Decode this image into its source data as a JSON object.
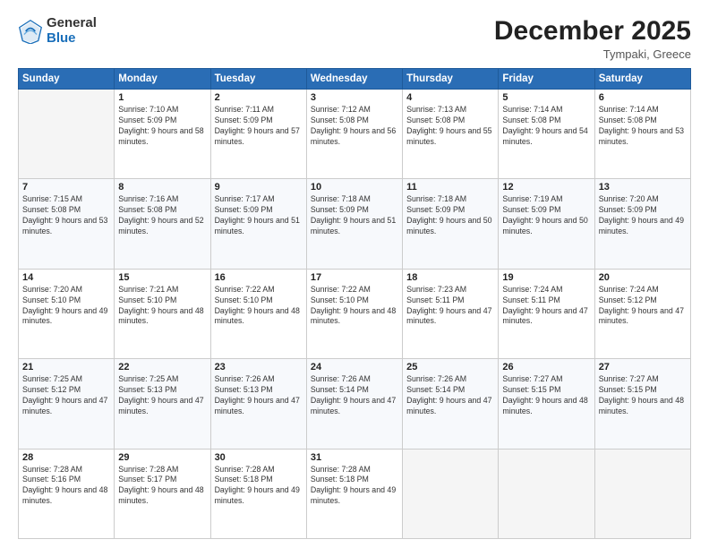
{
  "logo": {
    "general": "General",
    "blue": "Blue"
  },
  "title": "December 2025",
  "location": "Tympaki, Greece",
  "days_of_week": [
    "Sunday",
    "Monday",
    "Tuesday",
    "Wednesday",
    "Thursday",
    "Friday",
    "Saturday"
  ],
  "weeks": [
    [
      {
        "num": "",
        "empty": true
      },
      {
        "num": "1",
        "sunrise": "Sunrise: 7:10 AM",
        "sunset": "Sunset: 5:09 PM",
        "daylight": "Daylight: 9 hours and 58 minutes."
      },
      {
        "num": "2",
        "sunrise": "Sunrise: 7:11 AM",
        "sunset": "Sunset: 5:09 PM",
        "daylight": "Daylight: 9 hours and 57 minutes."
      },
      {
        "num": "3",
        "sunrise": "Sunrise: 7:12 AM",
        "sunset": "Sunset: 5:08 PM",
        "daylight": "Daylight: 9 hours and 56 minutes."
      },
      {
        "num": "4",
        "sunrise": "Sunrise: 7:13 AM",
        "sunset": "Sunset: 5:08 PM",
        "daylight": "Daylight: 9 hours and 55 minutes."
      },
      {
        "num": "5",
        "sunrise": "Sunrise: 7:14 AM",
        "sunset": "Sunset: 5:08 PM",
        "daylight": "Daylight: 9 hours and 54 minutes."
      },
      {
        "num": "6",
        "sunrise": "Sunrise: 7:14 AM",
        "sunset": "Sunset: 5:08 PM",
        "daylight": "Daylight: 9 hours and 53 minutes."
      }
    ],
    [
      {
        "num": "7",
        "sunrise": "Sunrise: 7:15 AM",
        "sunset": "Sunset: 5:08 PM",
        "daylight": "Daylight: 9 hours and 53 minutes."
      },
      {
        "num": "8",
        "sunrise": "Sunrise: 7:16 AM",
        "sunset": "Sunset: 5:08 PM",
        "daylight": "Daylight: 9 hours and 52 minutes."
      },
      {
        "num": "9",
        "sunrise": "Sunrise: 7:17 AM",
        "sunset": "Sunset: 5:09 PM",
        "daylight": "Daylight: 9 hours and 51 minutes."
      },
      {
        "num": "10",
        "sunrise": "Sunrise: 7:18 AM",
        "sunset": "Sunset: 5:09 PM",
        "daylight": "Daylight: 9 hours and 51 minutes."
      },
      {
        "num": "11",
        "sunrise": "Sunrise: 7:18 AM",
        "sunset": "Sunset: 5:09 PM",
        "daylight": "Daylight: 9 hours and 50 minutes."
      },
      {
        "num": "12",
        "sunrise": "Sunrise: 7:19 AM",
        "sunset": "Sunset: 5:09 PM",
        "daylight": "Daylight: 9 hours and 50 minutes."
      },
      {
        "num": "13",
        "sunrise": "Sunrise: 7:20 AM",
        "sunset": "Sunset: 5:09 PM",
        "daylight": "Daylight: 9 hours and 49 minutes."
      }
    ],
    [
      {
        "num": "14",
        "sunrise": "Sunrise: 7:20 AM",
        "sunset": "Sunset: 5:10 PM",
        "daylight": "Daylight: 9 hours and 49 minutes."
      },
      {
        "num": "15",
        "sunrise": "Sunrise: 7:21 AM",
        "sunset": "Sunset: 5:10 PM",
        "daylight": "Daylight: 9 hours and 48 minutes."
      },
      {
        "num": "16",
        "sunrise": "Sunrise: 7:22 AM",
        "sunset": "Sunset: 5:10 PM",
        "daylight": "Daylight: 9 hours and 48 minutes."
      },
      {
        "num": "17",
        "sunrise": "Sunrise: 7:22 AM",
        "sunset": "Sunset: 5:10 PM",
        "daylight": "Daylight: 9 hours and 48 minutes."
      },
      {
        "num": "18",
        "sunrise": "Sunrise: 7:23 AM",
        "sunset": "Sunset: 5:11 PM",
        "daylight": "Daylight: 9 hours and 47 minutes."
      },
      {
        "num": "19",
        "sunrise": "Sunrise: 7:24 AM",
        "sunset": "Sunset: 5:11 PM",
        "daylight": "Daylight: 9 hours and 47 minutes."
      },
      {
        "num": "20",
        "sunrise": "Sunrise: 7:24 AM",
        "sunset": "Sunset: 5:12 PM",
        "daylight": "Daylight: 9 hours and 47 minutes."
      }
    ],
    [
      {
        "num": "21",
        "sunrise": "Sunrise: 7:25 AM",
        "sunset": "Sunset: 5:12 PM",
        "daylight": "Daylight: 9 hours and 47 minutes."
      },
      {
        "num": "22",
        "sunrise": "Sunrise: 7:25 AM",
        "sunset": "Sunset: 5:13 PM",
        "daylight": "Daylight: 9 hours and 47 minutes."
      },
      {
        "num": "23",
        "sunrise": "Sunrise: 7:26 AM",
        "sunset": "Sunset: 5:13 PM",
        "daylight": "Daylight: 9 hours and 47 minutes."
      },
      {
        "num": "24",
        "sunrise": "Sunrise: 7:26 AM",
        "sunset": "Sunset: 5:14 PM",
        "daylight": "Daylight: 9 hours and 47 minutes."
      },
      {
        "num": "25",
        "sunrise": "Sunrise: 7:26 AM",
        "sunset": "Sunset: 5:14 PM",
        "daylight": "Daylight: 9 hours and 47 minutes."
      },
      {
        "num": "26",
        "sunrise": "Sunrise: 7:27 AM",
        "sunset": "Sunset: 5:15 PM",
        "daylight": "Daylight: 9 hours and 48 minutes."
      },
      {
        "num": "27",
        "sunrise": "Sunrise: 7:27 AM",
        "sunset": "Sunset: 5:15 PM",
        "daylight": "Daylight: 9 hours and 48 minutes."
      }
    ],
    [
      {
        "num": "28",
        "sunrise": "Sunrise: 7:28 AM",
        "sunset": "Sunset: 5:16 PM",
        "daylight": "Daylight: 9 hours and 48 minutes."
      },
      {
        "num": "29",
        "sunrise": "Sunrise: 7:28 AM",
        "sunset": "Sunset: 5:17 PM",
        "daylight": "Daylight: 9 hours and 48 minutes."
      },
      {
        "num": "30",
        "sunrise": "Sunrise: 7:28 AM",
        "sunset": "Sunset: 5:18 PM",
        "daylight": "Daylight: 9 hours and 49 minutes."
      },
      {
        "num": "31",
        "sunrise": "Sunrise: 7:28 AM",
        "sunset": "Sunset: 5:18 PM",
        "daylight": "Daylight: 9 hours and 49 minutes."
      },
      {
        "num": "",
        "empty": true
      },
      {
        "num": "",
        "empty": true
      },
      {
        "num": "",
        "empty": true
      }
    ]
  ]
}
